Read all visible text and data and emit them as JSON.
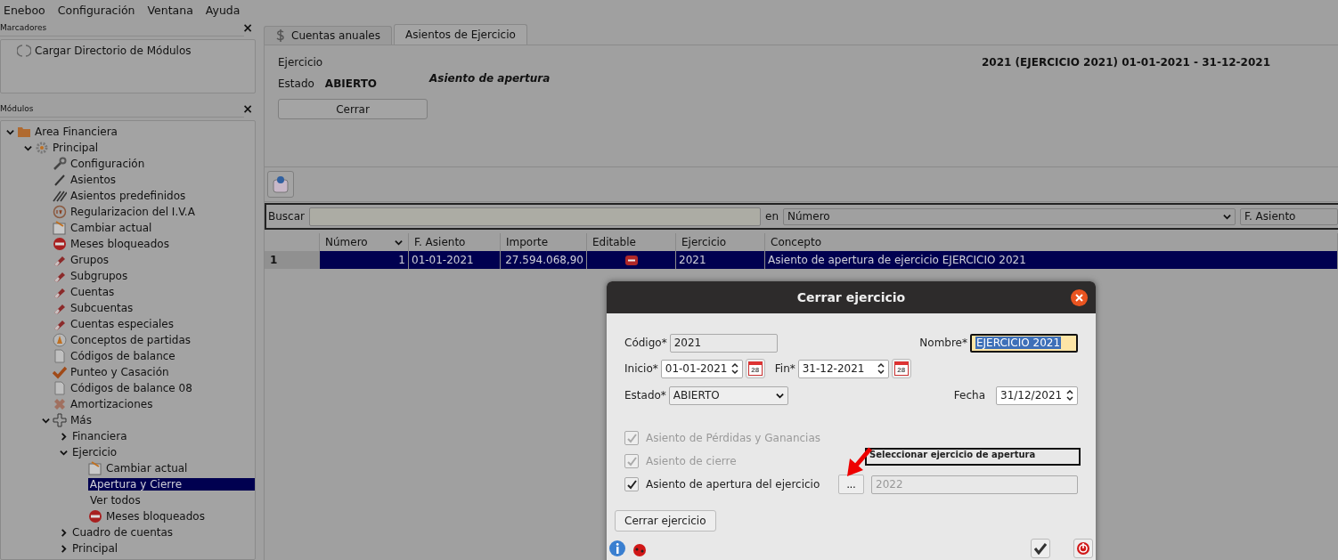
{
  "menu": [
    {
      "label": "Eneboo"
    },
    {
      "label": "Configuración"
    },
    {
      "label": "Ventana"
    },
    {
      "label": "Ayuda"
    }
  ],
  "bookmarks": {
    "title": "Marcadores",
    "close": "×",
    "items": [
      {
        "label": "Cargar Directorio de Módulos",
        "kind": "loader"
      }
    ]
  },
  "modules": {
    "title": "Módulos",
    "close": "×",
    "tree": [
      {
        "label": "Area Financiera",
        "kind": "folder",
        "expanded": true,
        "selected": false,
        "children": [
          {
            "label": "Principal",
            "kind": "gear",
            "expanded": true,
            "selected": false,
            "children": [
              {
                "label": "Configuración",
                "kind": "wrench",
                "selected": false
              },
              {
                "label": "Asientos",
                "kind": "pen",
                "selected": false
              },
              {
                "label": "Asientos predefinidos",
                "kind": "pens",
                "selected": false
              },
              {
                "label": "Regularizacion del I.V.A",
                "kind": "tax",
                "selected": false
              },
              {
                "label": "Cambiar actual",
                "kind": "calendar",
                "selected": false
              },
              {
                "label": "Meses bloqueados",
                "kind": "stop",
                "selected": false
              },
              {
                "label": "Grupos",
                "kind": "eraser",
                "selected": false
              },
              {
                "label": "Subgrupos",
                "kind": "eraser",
                "selected": false
              },
              {
                "label": "Cuentas",
                "kind": "eraser",
                "selected": false
              },
              {
                "label": "Subcuentas",
                "kind": "eraser",
                "selected": false
              },
              {
                "label": "Cuentas especiales",
                "kind": "eraser",
                "selected": false
              },
              {
                "label": "Conceptos de partidas",
                "kind": "compass",
                "selected": false
              },
              {
                "label": "Códigos de balance",
                "kind": "document",
                "selected": false
              },
              {
                "label": "Punteo y Casación",
                "kind": "check",
                "selected": false
              },
              {
                "label": "Códigos de balance 08",
                "kind": "document",
                "selected": false
              },
              {
                "label": "Amortizaciones",
                "kind": "bandage",
                "selected": false
              },
              {
                "label": "Más",
                "kind": "plus",
                "expanded": true,
                "selected": false,
                "children": [
                  {
                    "label": "Financiera",
                    "expanded": false,
                    "selected": false
                  },
                  {
                    "label": "Ejercicio",
                    "expanded": true,
                    "selected": false,
                    "children": [
                      {
                        "label": "Cambiar actual",
                        "kind": "calendar",
                        "selected": false
                      },
                      {
                        "label": "Apertura y Cierre",
                        "selected": true
                      },
                      {
                        "label": "Ver todos",
                        "selected": false
                      },
                      {
                        "label": "Meses bloqueados",
                        "kind": "stop",
                        "selected": false
                      }
                    ]
                  },
                  {
                    "label": "Cuadro de cuentas",
                    "expanded": false,
                    "selected": false
                  },
                  {
                    "label": "Principal",
                    "expanded": false,
                    "selected": false
                  }
                ]
              }
            ]
          }
        ]
      }
    ]
  },
  "tabs": [
    {
      "label": "Cuentas anuales",
      "selected": false
    },
    {
      "label": "Asientos de Ejercicio",
      "selected": true
    }
  ],
  "form": {
    "ejercicio_label": "Ejercicio",
    "ejercicio_value": "2021 (EJERCICIO 2021) 01-01-2021 - 31-12-2021",
    "estado_label": "Estado",
    "estado_value": "ABIERTO",
    "section_title": "Asiento de apertura",
    "close_button": "Cerrar"
  },
  "search": {
    "label": "Buscar",
    "in_label": "en",
    "field": "Número",
    "order": "F. Asiento"
  },
  "table": {
    "columns": [
      "Número",
      "F. Asiento",
      "Importe",
      "Editable",
      "Ejercicio",
      "Concepto"
    ],
    "rows": [
      {
        "header": "1",
        "selected": true,
        "cells": [
          "1",
          "01-01-2021",
          "27.594.068,90",
          "",
          "2021",
          "Asiento de apertura de ejercicio EJERCICIO 2021"
        ],
        "editable": false
      }
    ]
  },
  "dialog": {
    "title": "Cerrar ejercicio",
    "codigo_label": "Código*",
    "codigo": "2021",
    "nombre_label": "Nombre*",
    "nombre": "EJERCICIO 2021",
    "inicio_label": "Inicio*",
    "inicio": "01-01-2021",
    "inicio_calendar_day": "28",
    "fin_label": "Fin*",
    "fin": "31-12-2021",
    "fin_calendar_day": "28",
    "estado_label": "Estado*",
    "estado": "ABIERTO",
    "fecha_label": "Fecha",
    "fecha": "31/12/2021",
    "checks": [
      {
        "label": "Asiento de Pérdidas y Ganancias",
        "checked": true,
        "disabled": true
      },
      {
        "label": "Asiento de cierre",
        "checked": true,
        "disabled": true
      },
      {
        "label": "Asiento de apertura del ejercicio",
        "checked": true,
        "disabled": false
      }
    ],
    "pick_button": "...",
    "apertura": "2022",
    "tooltip": "Seleccionar ejercicio de apertura",
    "submit": "Cerrar ejercicio"
  }
}
